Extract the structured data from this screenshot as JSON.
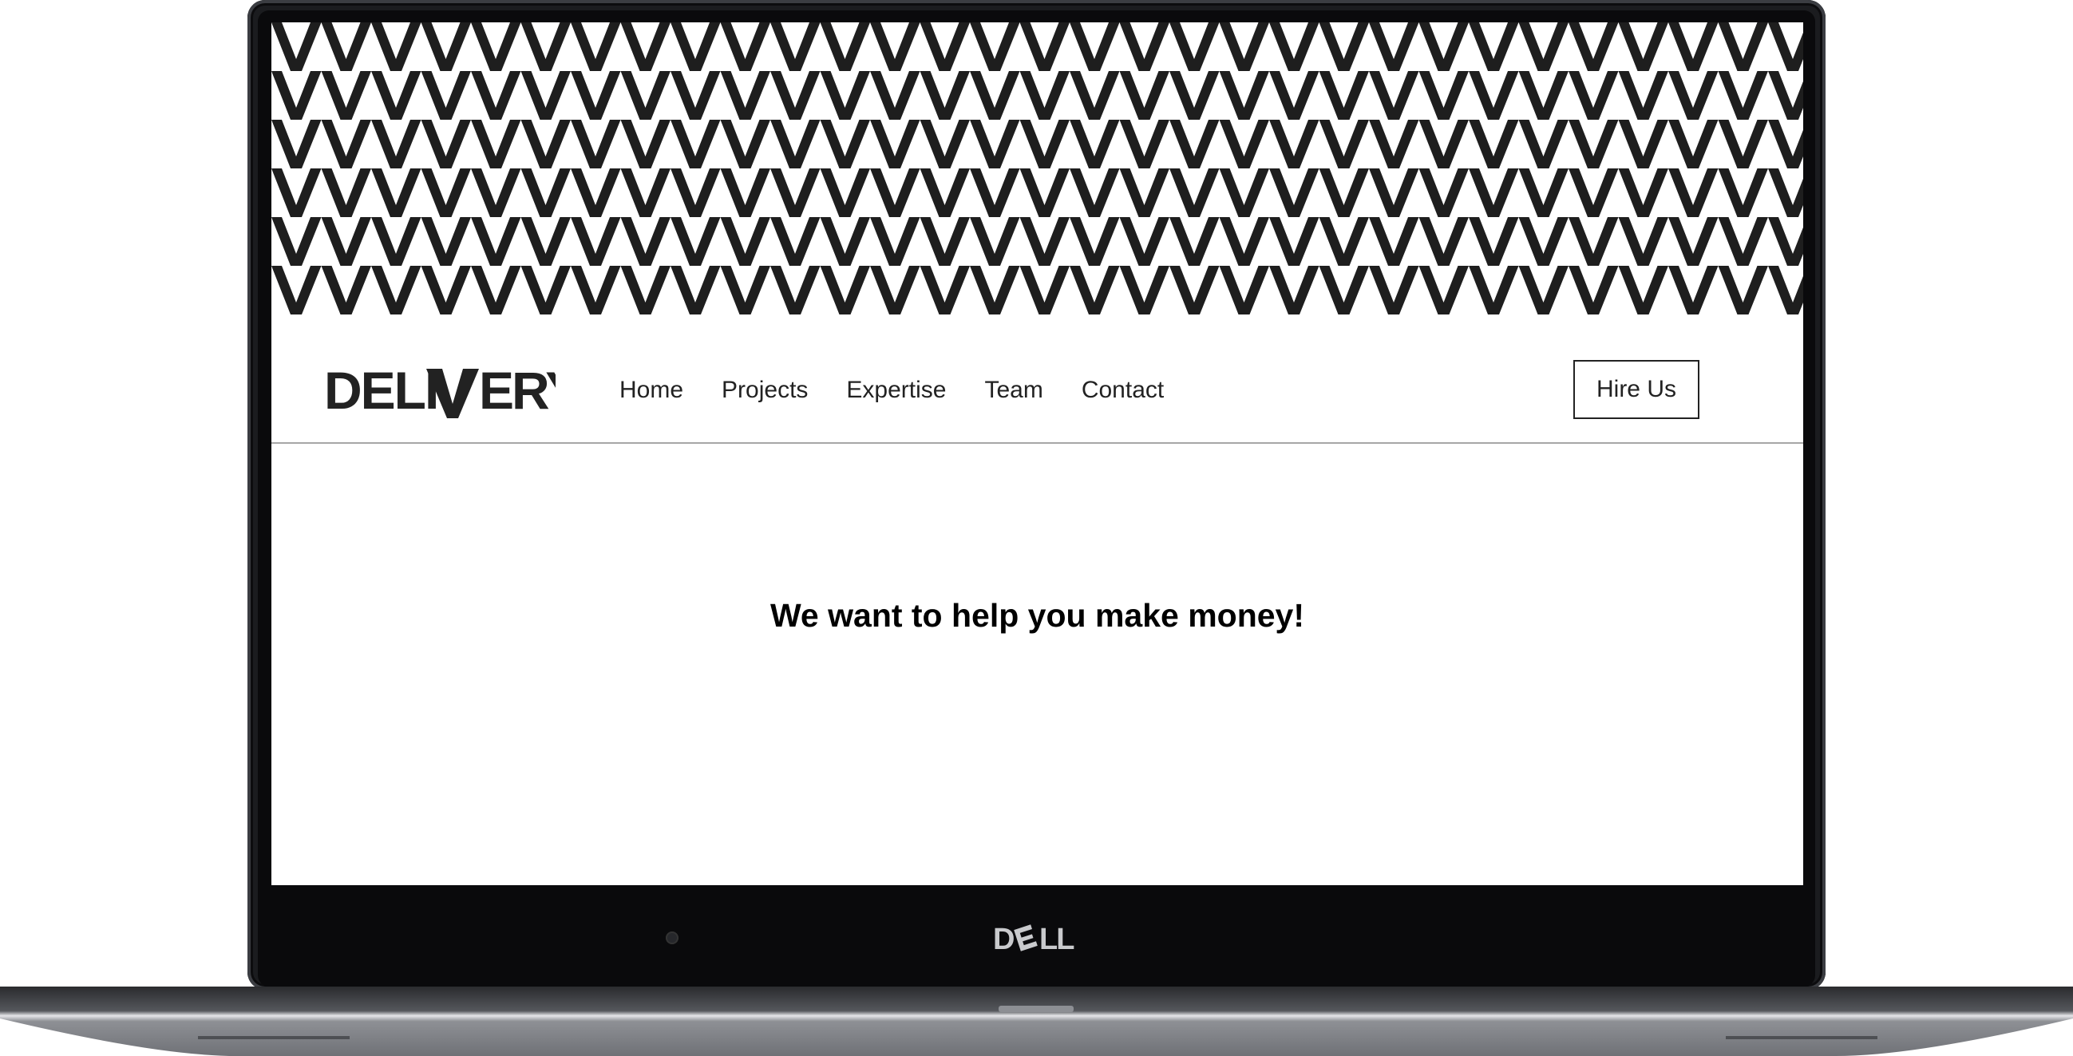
{
  "site": {
    "logo_text": "DELIVERY",
    "nav": [
      "Home",
      "Projects",
      "Expertise",
      "Team",
      "Contact"
    ],
    "cta_label": "Hire Us",
    "hero_text": "We want to help you make money!"
  },
  "device": {
    "brand": "DELL"
  },
  "colors": {
    "pattern_dark": "#1e1e1e",
    "pattern_light": "#ffffff",
    "text": "#222222",
    "divider": "#a6a6a6",
    "bezel": "#0a0a0c",
    "chassis": "#6f7176"
  },
  "icons": {
    "header_pattern": "chevron-pattern",
    "webcam": "webcam-icon"
  }
}
